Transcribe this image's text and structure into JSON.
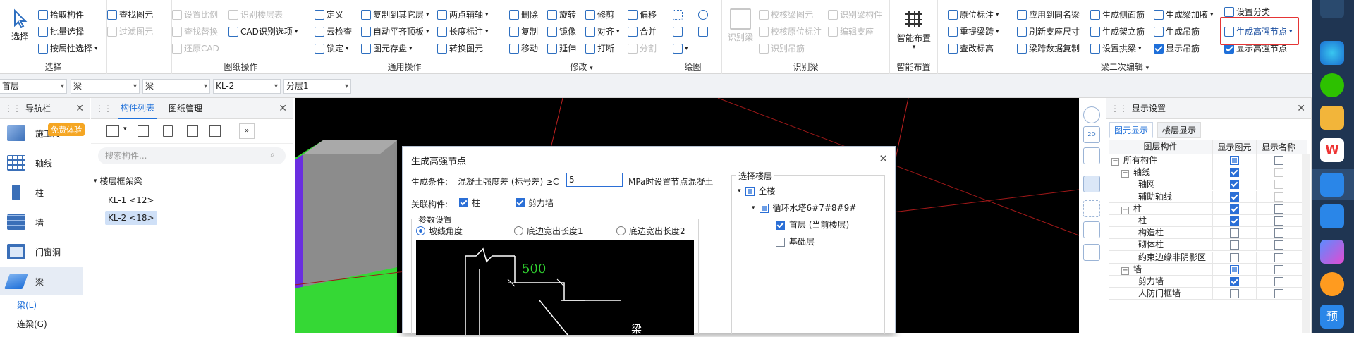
{
  "ribbon": {
    "select_group": {
      "big_button": "选择",
      "items": [
        "拾取构件",
        "批量选择",
        "按属性选择"
      ],
      "find": "查找图元",
      "filter": "过滤图元",
      "label": "选择"
    },
    "drawing_ops": {
      "items": [
        "设置比例",
        "查找替换",
        "还原CAD",
        "识别楼层表",
        "CAD识别选项"
      ],
      "label": "图纸操作"
    },
    "common_ops": {
      "items": [
        "定义",
        "云检查",
        "锁定",
        "复制到其它层",
        "自动平齐顶板",
        "图元存盘",
        "两点辅轴",
        "长度标注",
        "转换图元"
      ],
      "label": "通用操作"
    },
    "modify": {
      "items": [
        "删除",
        "旋转",
        "修剪",
        "偏移",
        "复制",
        "镜像",
        "对齐",
        "合并",
        "移动",
        "延伸",
        "打断",
        "分割"
      ],
      "label": "修改"
    },
    "draw": {
      "label": "绘图"
    },
    "recognize": {
      "big": "识别梁",
      "items": [
        "校核梁图元",
        "识别梁构件",
        "校核原位标注",
        "编辑支座",
        "识别吊筋"
      ],
      "label": "识别梁"
    },
    "smart": {
      "big": "智能布置",
      "label": "智能布置"
    },
    "beam_edit": {
      "items": [
        "原位标注",
        "应用到同名梁",
        "生成侧面筋",
        "生成梁加腋",
        "设置分类",
        "重提梁跨",
        "刷新支座尺寸",
        "生成架立筋",
        "生成吊筋",
        "查改标高",
        "梁跨数据复制",
        "设置拱梁"
      ],
      "gen_node": "生成高强节点",
      "show_rebar": "显示吊筋",
      "show_gen_node": "显示高强节点",
      "label": "梁二次编辑"
    }
  },
  "filterbar": {
    "floor": "首层",
    "type": "梁",
    "subtype": "梁",
    "component": "KL-2",
    "layer": "分层1"
  },
  "nav": {
    "title": "导航栏",
    "badge": "免费体验",
    "items": [
      "施工段",
      "轴线",
      "柱",
      "墙",
      "门窗洞",
      "梁"
    ],
    "sub_items": [
      "梁(L)",
      "连梁(G)"
    ]
  },
  "component_panel": {
    "tabs": [
      "构件列表",
      "图纸管理"
    ],
    "search_placeholder": "搜索构件...",
    "tree_root": "楼层框架梁",
    "items": [
      "KL-1 <12>",
      "KL-2 <18>"
    ]
  },
  "dialog": {
    "title": "生成高强节点",
    "condition_label": "生成条件:",
    "condition_text": "混凝土强度差 (标号差) ≥C",
    "condition_value": "5",
    "condition_suffix": "MPa时设置节点混凝土",
    "related_label": "关联构件:",
    "related": [
      "柱",
      "剪力墙"
    ],
    "params_title": "参数设置",
    "options": [
      "坡线角度",
      "底边宽出长度1",
      "底边宽出长度2"
    ],
    "diagram_value": "500",
    "diagram_beam": "梁",
    "floor_title": "选择楼层",
    "floors": [
      "全楼",
      "循环水塔6#7#8#9#",
      "首层 (当前楼层)",
      "基础层"
    ]
  },
  "display": {
    "title": "显示设置",
    "tabs": [
      "图元显示",
      "楼层显示"
    ],
    "headers": [
      "图层构件",
      "显示图元",
      "显示名称"
    ],
    "rows": [
      {
        "name": "所有构件",
        "level": 0,
        "exp": "−",
        "show": "part",
        "name_cb": "off"
      },
      {
        "name": "轴线",
        "level": 1,
        "exp": "−",
        "show": "on",
        "name_cb": "dis"
      },
      {
        "name": "轴网",
        "level": 2,
        "exp": "",
        "show": "on",
        "name_cb": "dis"
      },
      {
        "name": "辅助轴线",
        "level": 2,
        "exp": "",
        "show": "on",
        "name_cb": "dis"
      },
      {
        "name": "柱",
        "level": 1,
        "exp": "−",
        "show": "on",
        "name_cb": "off"
      },
      {
        "name": "柱",
        "level": 2,
        "exp": "",
        "show": "on",
        "name_cb": "off"
      },
      {
        "name": "构造柱",
        "level": 2,
        "exp": "",
        "show": "off",
        "name_cb": "off"
      },
      {
        "name": "砌体柱",
        "level": 2,
        "exp": "",
        "show": "off",
        "name_cb": "off"
      },
      {
        "name": "约束边缘非阴影区",
        "level": 2,
        "exp": "",
        "show": "off",
        "name_cb": "off"
      },
      {
        "name": "墙",
        "level": 1,
        "exp": "−",
        "show": "part",
        "name_cb": "off"
      },
      {
        "name": "剪力墙",
        "level": 2,
        "exp": "",
        "show": "on",
        "name_cb": "off"
      },
      {
        "name": "人防门框墙",
        "level": 2,
        "exp": "",
        "show": "off",
        "name_cb": "off"
      }
    ]
  },
  "taskbar": {
    "last_label": "预"
  },
  "colors": {
    "accent": "#1e6fd9",
    "highlight": "#e53535",
    "viewport_bg": "#000000",
    "wall_gray": "#8c8c8c",
    "slab_green": "#2fd12f",
    "column_purple": "#6a2ee0"
  }
}
